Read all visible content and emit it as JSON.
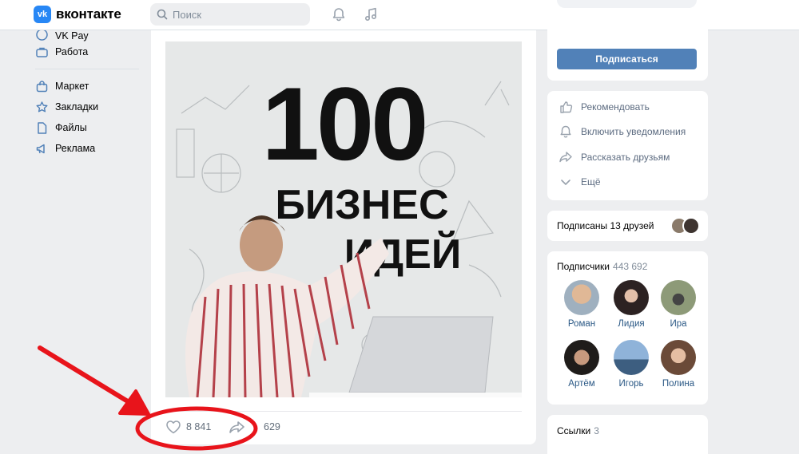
{
  "header": {
    "logo_mark": "vk",
    "logo_text": "вконтакте",
    "search_placeholder": "Поиск",
    "icons": [
      "search-icon",
      "bell-icon",
      "music-icon"
    ]
  },
  "sidebar": {
    "items_top": [
      {
        "label": "VK Pay",
        "icon": "vkpay-icon"
      },
      {
        "label": "Работа",
        "icon": "briefcase-icon"
      }
    ],
    "items_bottom": [
      {
        "label": "Маркет",
        "icon": "bag-icon"
      },
      {
        "label": "Закладки",
        "icon": "star-icon"
      },
      {
        "label": "Файлы",
        "icon": "file-icon"
      },
      {
        "label": "Реклама",
        "icon": "megaphone-icon"
      }
    ]
  },
  "post": {
    "image_text_number": "100",
    "image_text_line1": "БИЗНЕС",
    "image_text_line2": "ИДЕЙ",
    "likes": "8 841",
    "shares": "629"
  },
  "right": {
    "subscribe_label": "Подписаться",
    "actions": [
      {
        "label": "Рекомендовать",
        "icon": "thumbs-up-icon"
      },
      {
        "label": "Включить уведомления",
        "icon": "bell-icon"
      },
      {
        "label": "Рассказать друзьям",
        "icon": "share-icon"
      },
      {
        "label": "Ещё",
        "icon": "chevron-down-icon"
      }
    ],
    "friends_label": "Подписаны 13 друзей",
    "subscribers_title": "Подписчики",
    "subscribers_count": "443 692",
    "subscribers": [
      {
        "name": "Роман",
        "color": "#c9a27e"
      },
      {
        "name": "Лидия",
        "color": "#5a3a3a"
      },
      {
        "name": "Ира",
        "color": "#7b8a6a"
      },
      {
        "name": "Артём",
        "color": "#3b3530"
      },
      {
        "name": "Игорь",
        "color": "#8fb3d9"
      },
      {
        "name": "Полина",
        "color": "#b88a72"
      }
    ],
    "links_title": "Ссылки",
    "links_count": "3"
  },
  "colors": {
    "accent": "#5181b8",
    "annotation": "#e8141b"
  }
}
